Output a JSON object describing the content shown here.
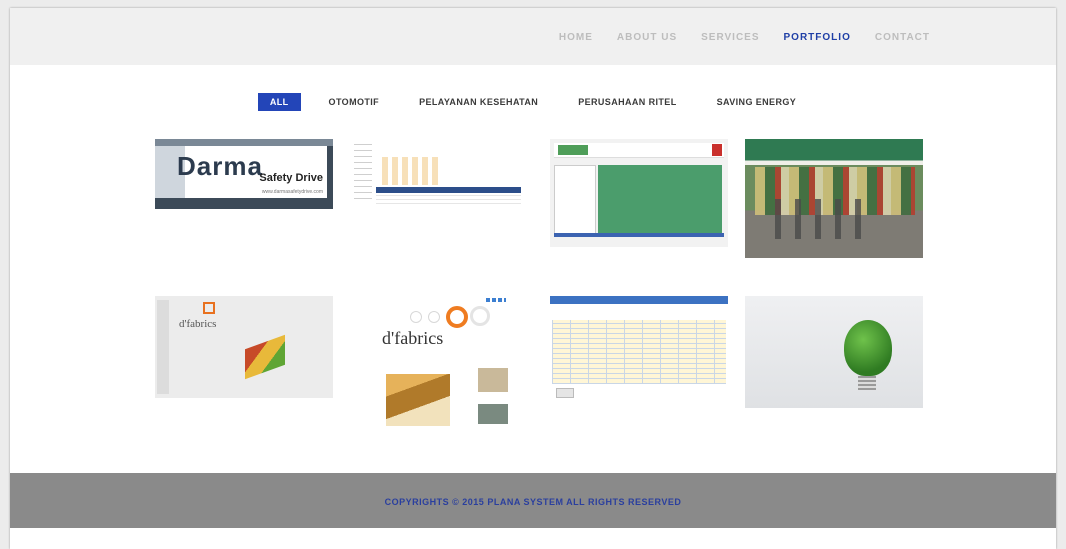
{
  "nav": {
    "items": [
      {
        "label": "HOME"
      },
      {
        "label": "ABOUT US"
      },
      {
        "label": "SERVICES"
      },
      {
        "label": "PORTFOLIO"
      },
      {
        "label": "CONTACT"
      }
    ],
    "active": "PORTFOLIO",
    "active_color": "#1f3fa6"
  },
  "filters": {
    "items": [
      {
        "label": "ALL"
      },
      {
        "label": "OTOMOTIF"
      },
      {
        "label": "PELAYANAN KESEHATAN"
      },
      {
        "label": "PERUSAHAAN RITEL"
      },
      {
        "label": "SAVING ENERGY"
      }
    ],
    "active": "ALL",
    "active_color": "#2345b8"
  },
  "portfolio": {
    "darma": {
      "logo": "Darma",
      "subtitle": "Safety Drive",
      "url": "www.darmasafetydrive.com"
    },
    "dfabrics_app": {
      "brand": "d'fabrics"
    },
    "dfabrics_site": {
      "brand": "d'fabrics"
    }
  },
  "footer": {
    "copyright": "COPYRIGHTS © 2015 PLANA SYSTEM ALL RIGHTS RESERVED"
  }
}
